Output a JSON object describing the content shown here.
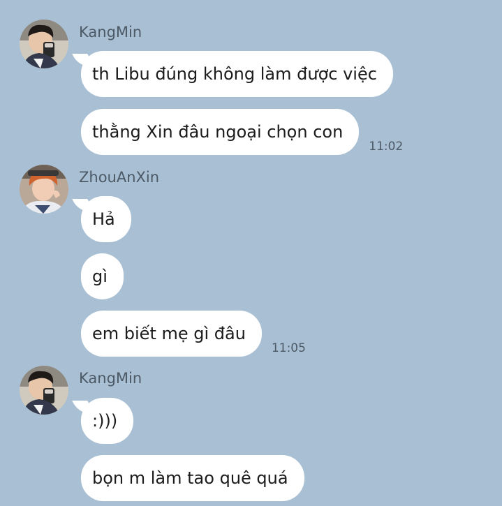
{
  "messages": [
    {
      "sender": "KangMin",
      "avatar": "kangmin-avatar",
      "bubbles": [
        {
          "text": "th Libu đúng không làm được việc"
        },
        {
          "text": "thằng Xin đâu ngoại chọn con",
          "time": "11:02"
        }
      ]
    },
    {
      "sender": "ZhouAnXin",
      "avatar": "zhouanxin-avatar",
      "bubbles": [
        {
          "text": "Hả"
        },
        {
          "text": "gì"
        },
        {
          "text": "em biết mẹ gì đâu",
          "time": "11:05"
        }
      ]
    },
    {
      "sender": "KangMin",
      "avatar": "kangmin-avatar",
      "bubbles": [
        {
          "text": ":)))"
        },
        {
          "text": "bọn m làm tao quê quá"
        }
      ]
    }
  ],
  "colors": {
    "background": "#a9bfd3",
    "bubble": "#ffffff",
    "meta_text": "#4c5966"
  }
}
